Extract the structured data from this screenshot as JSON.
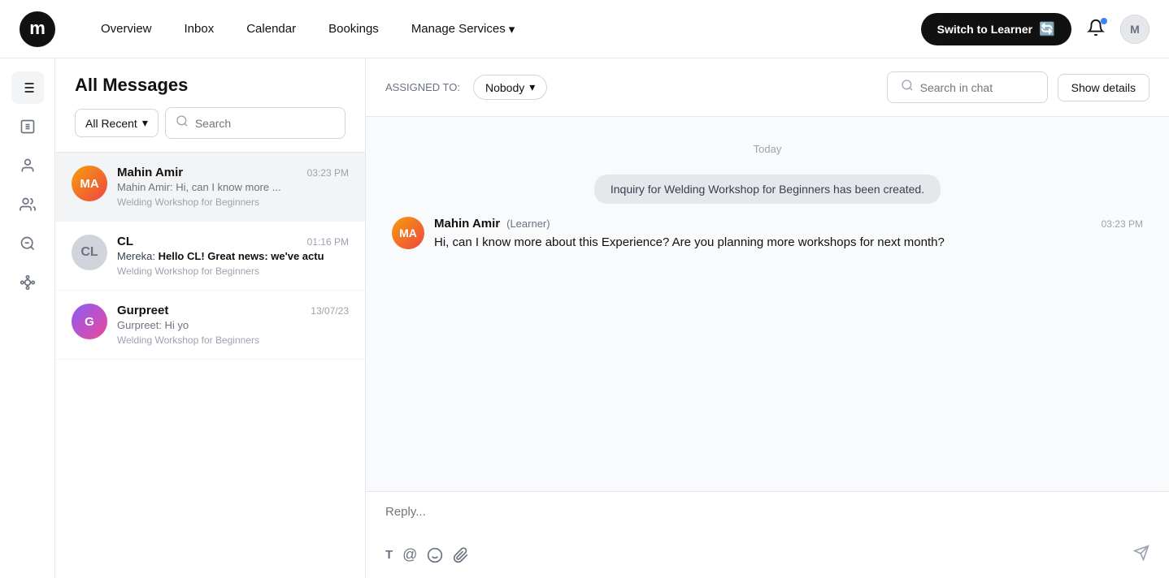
{
  "nav": {
    "logo_alt": "Mereka",
    "links": [
      {
        "label": "Overview",
        "name": "overview"
      },
      {
        "label": "Inbox",
        "name": "inbox"
      },
      {
        "label": "Calendar",
        "name": "calendar"
      },
      {
        "label": "Bookings",
        "name": "bookings"
      },
      {
        "label": "Manage Services",
        "name": "manage-services",
        "has_dropdown": true
      }
    ],
    "switch_btn": "Switch to Learner",
    "user_avatar_initials": "M"
  },
  "sidebar": {
    "icons": [
      {
        "name": "filter-icon",
        "label": "Filters"
      },
      {
        "name": "list-icon",
        "label": "List"
      },
      {
        "name": "user-icon",
        "label": "User"
      },
      {
        "name": "users-icon",
        "label": "Users"
      },
      {
        "name": "search-filter-icon",
        "label": "Search Filter"
      },
      {
        "name": "network-icon",
        "label": "Network"
      }
    ]
  },
  "messages_panel": {
    "title": "All Messages",
    "filter_label": "All Recent",
    "search_placeholder": "Search",
    "conversations": [
      {
        "id": "conv-mahin",
        "name": "Mahin Amir",
        "time": "03:23 PM",
        "preview": "Mahin Amir: Hi, can I know more ...",
        "tag": "Welding Workshop for Beginners",
        "avatar_initials": "MA",
        "active": true
      },
      {
        "id": "conv-cl",
        "name": "CL",
        "time": "01:16 PM",
        "preview": "Hello CL! Great news: we've actu",
        "preview_prefix": "Mereka:",
        "tag": "Welding Workshop for Beginners",
        "avatar_initials": "CL",
        "active": false
      },
      {
        "id": "conv-gurpreet",
        "name": "Gurpreet",
        "time": "13/07/23",
        "preview": "Gurpreet: Hi yo",
        "tag": "Welding Workshop for Beginners",
        "avatar_initials": "G",
        "active": false
      }
    ]
  },
  "chat": {
    "assigned_label": "ASSIGNED TO:",
    "assigned_value": "Nobody",
    "search_placeholder": "Search in chat",
    "show_details_label": "Show details",
    "date_divider": "Today",
    "system_message": "Inquiry for Welding Workshop for Beginners has been created.",
    "messages": [
      {
        "id": "msg-1",
        "sender_name": "Mahin Amir",
        "sender_role": "(Learner)",
        "time": "03:23 PM",
        "text": "Hi, can I know more about this Experience? Are you planning more workshops for next month?",
        "avatar_initials": "MA"
      }
    ],
    "reply_placeholder": "Reply...",
    "toolbar_buttons": [
      {
        "name": "bold-icon",
        "label": "Bold",
        "symbol": "T"
      },
      {
        "name": "mention-icon",
        "label": "Mention",
        "symbol": "@"
      },
      {
        "name": "emoji-icon",
        "label": "Emoji",
        "symbol": "☺"
      },
      {
        "name": "attach-icon",
        "label": "Attach",
        "symbol": "📎"
      }
    ],
    "send_icon": "send-icon"
  }
}
